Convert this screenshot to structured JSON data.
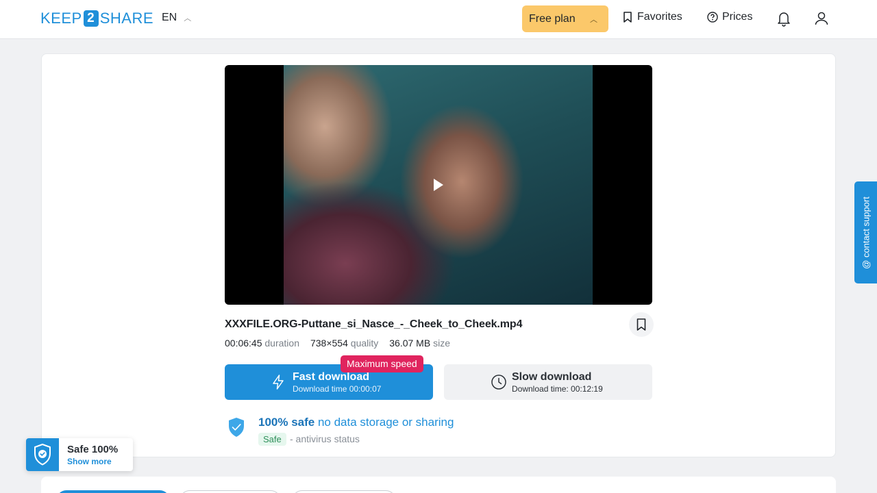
{
  "header": {
    "logo_left": "KEEP",
    "logo_mid": "2",
    "logo_right": "SHARE",
    "language": "EN",
    "plan_label": "Free plan",
    "favorites_label": "Favorites",
    "prices_label": "Prices"
  },
  "file": {
    "name": "XXXFILE.ORG-Puttane_si_Nasce_-_Cheek_to_Cheek.mp4",
    "duration": "00:06:45",
    "duration_label": "duration",
    "resolution": "738×554",
    "resolution_label": "quality",
    "size": "36.07 MB",
    "size_label": "size"
  },
  "download": {
    "fast_title": "Fast download",
    "fast_sub": "Download time 00:00:07",
    "badge": "Maximum speed",
    "slow_title": "Slow download",
    "slow_sub": "Download time: 00:12:19"
  },
  "safety": {
    "bold": "100% safe",
    "rest": " no data storage or sharing",
    "tag": "Safe",
    "status": "- antivirus status"
  },
  "support": {
    "label": "@ contact support"
  },
  "widget": {
    "title": "Safe 100%",
    "link": "Show more"
  },
  "colors": {
    "accent": "#1f8fd9",
    "plan": "#fbc86a",
    "badge": "#e0245e"
  }
}
